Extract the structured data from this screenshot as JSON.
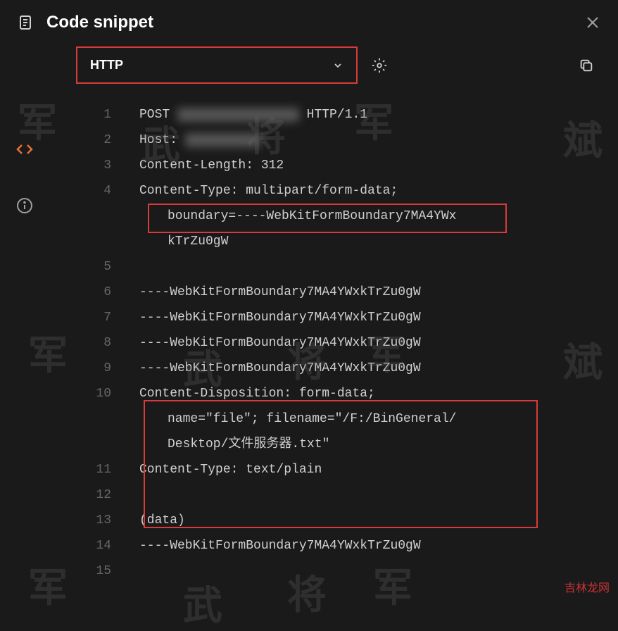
{
  "header": {
    "title": "Code snippet"
  },
  "controls": {
    "dropdown_label": "HTTP"
  },
  "code": {
    "lines": [
      {
        "num": "1",
        "text": "POST ",
        "blurred": "████████████████",
        "suffix": " HTTP/1.1"
      },
      {
        "num": "2",
        "text": "Host: ",
        "blurred": "██████████"
      },
      {
        "num": "3",
        "text": "Content-Length: 312"
      },
      {
        "num": "4",
        "text": "Content-Type: multipart/form-data;",
        "wrap": [
          "boundary=----WebKitFormBoundary7MA4YWx",
          "kTrZu0gW"
        ]
      },
      {
        "num": "5",
        "text": ""
      },
      {
        "num": "6",
        "text": "----WebKitFormBoundary7MA4YWxkTrZu0gW"
      },
      {
        "num": "7",
        "text": "----WebKitFormBoundary7MA4YWxkTrZu0gW"
      },
      {
        "num": "8",
        "text": "----WebKitFormBoundary7MA4YWxkTrZu0gW"
      },
      {
        "num": "9",
        "text": "----WebKitFormBoundary7MA4YWxkTrZu0gW"
      },
      {
        "num": "10",
        "text": "Content-Disposition: form-data;",
        "wrap": [
          "name=\"file\"; filename=\"/F:/BinGeneral/",
          "Desktop/文件服务器.txt\""
        ]
      },
      {
        "num": "11",
        "text": "Content-Type: text/plain"
      },
      {
        "num": "12",
        "text": ""
      },
      {
        "num": "13",
        "text": "(data)"
      },
      {
        "num": "14",
        "text": "----WebKitFormBoundary7MA4YWxkTrZu0gW"
      },
      {
        "num": "15",
        "text": ""
      }
    ]
  },
  "watermarks": {
    "w1": "军",
    "w2": "将",
    "w3": "武",
    "w4": "斌",
    "site": "吉林龙网"
  }
}
